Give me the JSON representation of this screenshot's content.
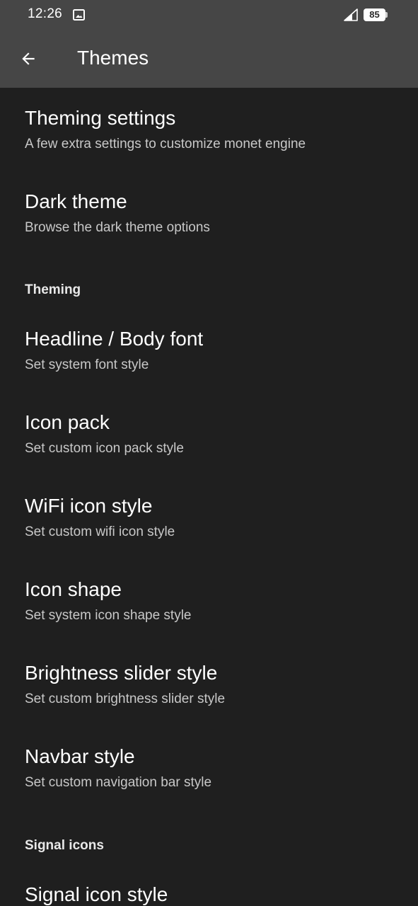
{
  "status_bar": {
    "time": "12:26",
    "battery_level": "85",
    "icons": [
      "image-icon",
      "signal-icon",
      "battery-icon"
    ]
  },
  "app_bar": {
    "title": "Themes",
    "back_icon": "arrow-back-icon"
  },
  "items": [
    {
      "title": "Theming settings",
      "summary": "A few extra settings to customize monet engine"
    },
    {
      "title": "Dark theme",
      "summary": "Browse the dark theme options"
    },
    {
      "title": "Headline / Body font",
      "summary": "Set system font style"
    },
    {
      "title": "Icon pack",
      "summary": "Set custom icon pack style"
    },
    {
      "title": "WiFi icon style",
      "summary": "Set custom wifi icon style"
    },
    {
      "title": "Icon shape",
      "summary": "Set system icon shape style"
    },
    {
      "title": "Brightness slider style",
      "summary": "Set custom brightness slider style"
    },
    {
      "title": "Navbar style",
      "summary": "Set custom navigation bar style"
    },
    {
      "title": "Signal icon style",
      "summary": ""
    }
  ],
  "categories": {
    "theming": "Theming",
    "signal_icons": "Signal icons"
  },
  "colors": {
    "status_bar_bg": "#464646",
    "background": "#1f1f1f",
    "title_text": "#ffffff",
    "summary_text": "#c8c8c8"
  }
}
